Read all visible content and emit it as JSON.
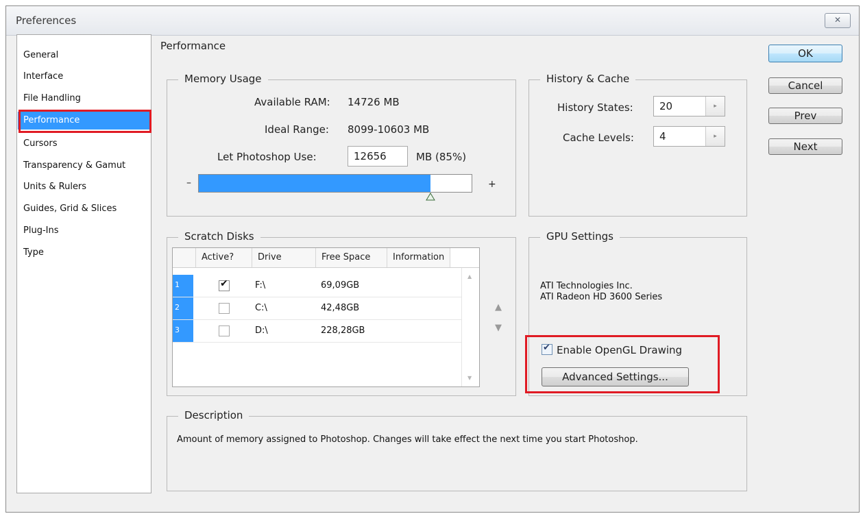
{
  "window": {
    "title": "Preferences",
    "close_glyph": "✕"
  },
  "categories": [
    {
      "label": "General",
      "selected": false
    },
    {
      "label": "Interface",
      "selected": false
    },
    {
      "label": "File Handling",
      "selected": false
    },
    {
      "label": "Performance",
      "selected": true
    },
    {
      "label": "Cursors",
      "selected": false
    },
    {
      "label": "Transparency & Gamut",
      "selected": false
    },
    {
      "label": "Units & Rulers",
      "selected": false
    },
    {
      "label": "Guides, Grid & Slices",
      "selected": false
    },
    {
      "label": "Plug-Ins",
      "selected": false
    },
    {
      "label": "Type",
      "selected": false
    }
  ],
  "section_title": "Performance",
  "memory": {
    "legend": "Memory Usage",
    "available_label": "Available RAM:",
    "available_value": "14726 MB",
    "ideal_label": "Ideal Range:",
    "ideal_value": "8099-10603 MB",
    "use_label": "Let Photoshop Use:",
    "use_value": "12656",
    "use_suffix": "MB (85%)",
    "minus": "–",
    "plus": "+",
    "slider_fraction": 0.85
  },
  "history": {
    "legend": "History & Cache",
    "states_label": "History States:",
    "states_value": "20",
    "cache_label": "Cache Levels:",
    "cache_value": "4",
    "spin_glyph": "▸"
  },
  "buttons": {
    "ok": "OK",
    "cancel": "Cancel",
    "prev": "Prev",
    "next": "Next"
  },
  "scratch": {
    "legend": "Scratch Disks",
    "headers": [
      "Active?",
      "Drive",
      "Free Space",
      "Information"
    ],
    "rows": [
      {
        "num": "1",
        "active": true,
        "drive": "F:\\",
        "free": "69,09GB",
        "info": ""
      },
      {
        "num": "2",
        "active": false,
        "drive": "C:\\",
        "free": "42,48GB",
        "info": ""
      },
      {
        "num": "3",
        "active": false,
        "drive": "D:\\",
        "free": "228,28GB",
        "info": ""
      }
    ],
    "check_glyph": "✔",
    "up_arrow": "▲",
    "down_arrow": "▼",
    "scroll_up": "▲",
    "scroll_down": "▼"
  },
  "gpu": {
    "legend": "GPU Settings",
    "vendor": "ATI Technologies Inc.",
    "model": "ATI Radeon HD 3600 Series",
    "opengl_label": "Enable OpenGL Drawing",
    "opengl_checked": true,
    "check_glyph": "✔",
    "advanced_label": "Advanced Settings..."
  },
  "description": {
    "legend": "Description",
    "text": "Amount of memory assigned to Photoshop. Changes will take effect the next time you start Photoshop."
  },
  "colors": {
    "selection": "#3399ff",
    "highlight_red": "#e01b24"
  }
}
